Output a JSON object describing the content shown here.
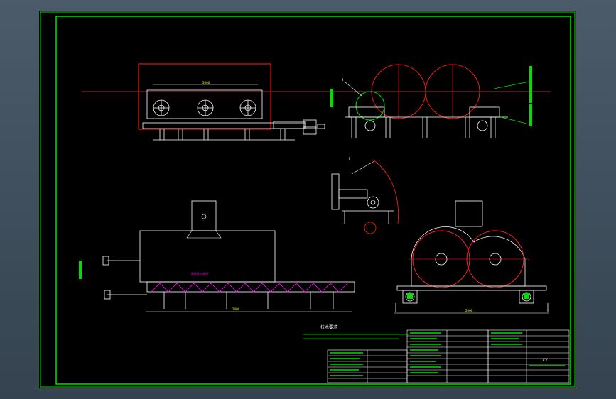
{
  "colors": {
    "border": "#00e000",
    "line": "#ffffff",
    "red": "#ff2020",
    "yellow": "#ffff00",
    "magenta": "#ff00ff",
    "cyan": "#00ffff",
    "centerline": "#ff3030"
  },
  "drawing": {
    "title_block": {
      "code": "XY"
    },
    "notes_heading": "技术要求"
  }
}
